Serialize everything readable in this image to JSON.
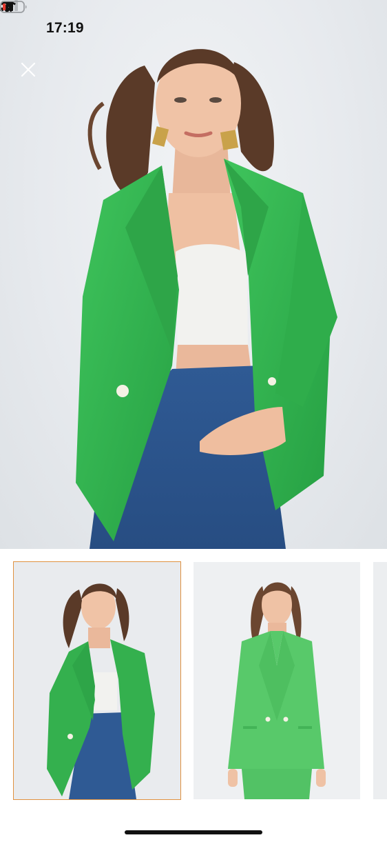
{
  "status_bar": {
    "time": "17:19",
    "icons": [
      "bell-slash-icon",
      "cellular-signal-icon",
      "wifi-icon",
      "battery-low-icon"
    ],
    "battery_level": 0.15,
    "battery_color": "#e5392f"
  },
  "viewer": {
    "close_icon": "close-icon",
    "main_image": "model-green-blazer-jeans-front",
    "selected_index": 0
  },
  "thumbnails": [
    {
      "image": "model-green-blazer-jeans",
      "selected": true
    },
    {
      "image": "model-green-blazer-skirt-suit",
      "selected": false
    },
    {
      "image": "partial-next-thumbnail",
      "selected": false
    }
  ],
  "colors": {
    "blazer_green": "#34b04e",
    "selection_outline": "#e0913f",
    "background": "#ffffff"
  }
}
